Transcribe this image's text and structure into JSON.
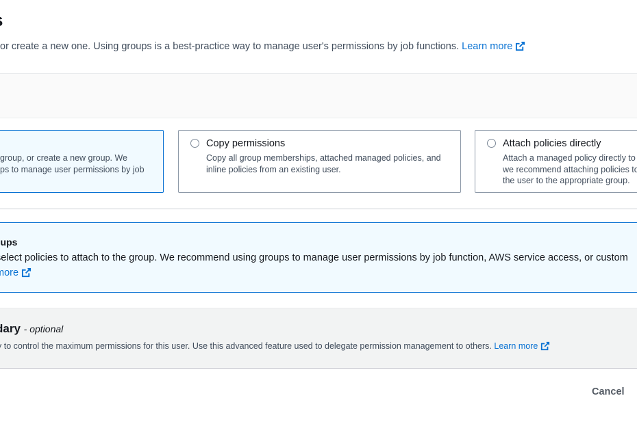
{
  "page": {
    "title": "s",
    "intro_text": "or create a new one. Using groups is a best-practice way to manage user's permissions by job functions.",
    "intro_link": "Learn more",
    "external_icon": "external-link-icon"
  },
  "options": {
    "heading": "",
    "cards": [
      {
        "title": "",
        "desc_line1": "group, or create a new group. We",
        "desc_line2": "ps to manage user permissions by job",
        "desc_line3": "",
        "selected": true
      },
      {
        "title": "Copy permissions",
        "desc_line1": "Copy all group memberships, attached managed policies, and",
        "desc_line2": "inline policies from an existing user.",
        "desc_line3": "",
        "selected": false
      },
      {
        "title": "Attach policies directly",
        "desc_line1": "Attach a managed policy directly to",
        "desc_line2": "we recommend attaching policies to",
        "desc_line3": "the user to the appropriate group.",
        "selected": false
      }
    ]
  },
  "groups_panel": {
    "title": "oups",
    "line1": "select policies to attach to the group. We recommend using groups to manage user permissions by job function, AWS service access, or custom",
    "link": "more"
  },
  "boundary": {
    "title": "dary",
    "optional": "- optional",
    "desc": "y to control the maximum permissions for this user. Use this advanced feature used to delegate permission management to others.",
    "link": "Learn more"
  },
  "footer": {
    "cancel_label": "Cancel"
  },
  "colors": {
    "accent": "#0972d3",
    "selected_bg": "#f1faff"
  }
}
